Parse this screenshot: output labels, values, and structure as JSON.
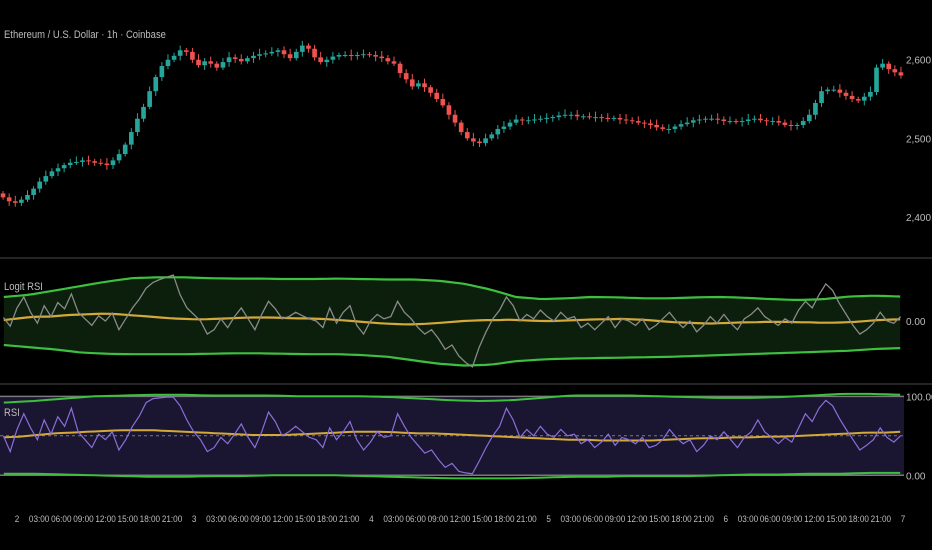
{
  "header": {
    "title": "Ethereum / U.S. Dollar · 1h · Coinbase"
  },
  "colors": {
    "background": "#000000",
    "candle_up": "#26a69a",
    "candle_down": "#ef5350",
    "band": "#3fbf3f",
    "signal": "#d4a93a",
    "logit_line": "#8a8a8a",
    "rsi_line": "#8a6fd8",
    "rsi_fill": "#1a1530",
    "logit_fill": "#0c1e0c",
    "divider": "#4a4a4a",
    "axis_text": "#bdbdbd"
  },
  "chart_data": [
    {
      "type": "candlestick",
      "title": "Ethereum / U.S. Dollar · 1h · Coinbase",
      "y_ticks": [
        "2,600.00",
        "2,500.00",
        "2,400.00"
      ],
      "y_tick_values": [
        2600,
        2500,
        2400
      ],
      "ylim": [
        2358,
        2648
      ],
      "x_ticks": [
        "2",
        "03:00",
        "06:00",
        "09:00",
        "12:00",
        "15:00",
        "18:00",
        "21:00",
        "3",
        "03:00",
        "06:00",
        "09:00",
        "12:00",
        "15:00",
        "18:00",
        "21:00",
        "4",
        "03:00",
        "06:00",
        "09:00",
        "12:00",
        "15:00",
        "18:00",
        "21:00",
        "5",
        "03:00",
        "06:00",
        "09:00",
        "12:00",
        "15:00",
        "18:00",
        "21:00",
        "6",
        "03:00",
        "06:00",
        "09:00",
        "12:00",
        "15:00",
        "18:00",
        "21:00",
        "7"
      ],
      "close": [
        2425,
        2420,
        2418,
        2422,
        2428,
        2436,
        2445,
        2452,
        2458,
        2462,
        2466,
        2469,
        2470,
        2472,
        2471,
        2469,
        2468,
        2466,
        2472,
        2480,
        2492,
        2508,
        2525,
        2540,
        2560,
        2578,
        2592,
        2600,
        2605,
        2612,
        2610,
        2600,
        2593,
        2598,
        2595,
        2590,
        2597,
        2603,
        2601,
        2598,
        2602,
        2605,
        2607,
        2608,
        2610,
        2612,
        2607,
        2602,
        2610,
        2618,
        2614,
        2603,
        2597,
        2600,
        2604,
        2606,
        2606,
        2605,
        2606,
        2607,
        2606,
        2604,
        2602,
        2598,
        2595,
        2583,
        2575,
        2566,
        2570,
        2565,
        2558,
        2550,
        2542,
        2530,
        2520,
        2508,
        2500,
        2496,
        2494,
        2500,
        2505,
        2512,
        2515,
        2520,
        2524,
        2523,
        2523,
        2524,
        2525,
        2526,
        2527,
        2529,
        2530,
        2530,
        2528,
        2528,
        2527,
        2527,
        2526,
        2525,
        2526,
        2524,
        2523,
        2522,
        2520,
        2519,
        2517,
        2514,
        2512,
        2512,
        2515,
        2518,
        2520,
        2523,
        2524,
        2525,
        2525,
        2524,
        2522,
        2522,
        2521,
        2522,
        2524,
        2525,
        2523,
        2522,
        2522,
        2520,
        2517,
        2516,
        2517,
        2522,
        2530,
        2545,
        2560,
        2562,
        2562,
        2558,
        2554,
        2550,
        2548,
        2553,
        2559,
        2590,
        2595,
        2588,
        2584,
        2580
      ]
    },
    {
      "type": "line",
      "title": "Logit RSI",
      "y_ticks": [
        "0.00"
      ],
      "y_tick_values": [
        0
      ],
      "ylim": [
        -1.35,
        1.35
      ],
      "series": [
        {
          "role": "logit_rsi",
          "values": [
            0.08,
            -0.12,
            0.3,
            0.55,
            0.2,
            -0.05,
            0.35,
            0.1,
            0.42,
            0.28,
            0.62,
            0.2,
            0.05,
            -0.1,
            0.12,
            0.0,
            0.18,
            -0.2,
            0.05,
            0.3,
            0.5,
            0.75,
            0.88,
            0.95,
            1.0,
            1.05,
            0.6,
            0.3,
            0.15,
            0.0,
            -0.3,
            -0.2,
            0.05,
            -0.15,
            0.1,
            0.3,
            0.05,
            -0.2,
            0.15,
            0.45,
            0.28,
            0.05,
            0.1,
            0.2,
            0.12,
            0.05,
            0.0,
            -0.15,
            0.3,
            -0.05,
            0.2,
            0.35,
            -0.1,
            -0.3,
            0.0,
            0.15,
            0.05,
            0.1,
            0.45,
            0.2,
            0.05,
            -0.15,
            -0.3,
            -0.2,
            -0.4,
            -0.65,
            -0.55,
            -0.8,
            -0.95,
            -1.05,
            -0.6,
            -0.25,
            0.05,
            0.25,
            0.55,
            0.35,
            0.0,
            0.15,
            0.05,
            0.25,
            0.1,
            0.0,
            0.2,
            0.05,
            0.1,
            -0.15,
            -0.05,
            -0.2,
            -0.05,
            0.1,
            -0.15,
            0.05,
            0.0,
            -0.1,
            0.05,
            -0.2,
            -0.1,
            0.05,
            0.2,
            0.0,
            -0.15,
            0.0,
            -0.25,
            -0.1,
            0.1,
            -0.05,
            0.15,
            -0.05,
            -0.2,
            0.05,
            0.15,
            0.3,
            0.1,
            0.0,
            -0.1,
            0.05,
            -0.05,
            0.25,
            0.45,
            0.3,
            0.6,
            0.85,
            0.7,
            0.4,
            0.15,
            -0.1,
            -0.3,
            -0.2,
            -0.05,
            0.2,
            0.0,
            -0.05,
            0.1
          ]
        },
        {
          "role": "signal",
          "values": [
            0.02,
            0.05,
            0.08,
            0.1,
            0.1,
            0.12,
            0.14,
            0.15,
            0.16,
            0.17,
            0.16,
            0.14,
            0.12,
            0.1,
            0.08,
            0.06,
            0.05,
            0.04,
            0.04,
            0.05,
            0.06,
            0.07,
            0.08,
            0.08,
            0.08,
            0.07,
            0.06,
            0.06,
            0.05,
            0.04,
            0.02,
            0.0,
            -0.02,
            -0.04,
            -0.06,
            -0.07,
            -0.08,
            -0.07,
            -0.06,
            -0.04,
            -0.02,
            0.0,
            0.01,
            0.02,
            0.02,
            0.03,
            0.02,
            0.01,
            0.0,
            0.0,
            0.01,
            0.02,
            0.03,
            0.04,
            0.04,
            0.05,
            0.04,
            0.03,
            0.01,
            -0.01,
            -0.03,
            -0.04,
            -0.05,
            -0.06,
            -0.05,
            -0.04,
            -0.03,
            -0.03,
            -0.02,
            -0.02,
            -0.02,
            -0.03,
            -0.03,
            -0.04,
            -0.04,
            -0.03,
            -0.02,
            0.0,
            0.02,
            0.03,
            0.04
          ]
        },
        {
          "role": "upper_band",
          "values": [
            0.55,
            0.6,
            0.7,
            0.8,
            0.9,
            0.98,
            1.0,
            1.0,
            0.98,
            0.97,
            0.97,
            0.96,
            0.96,
            0.97,
            0.96,
            0.95,
            0.95,
            0.92,
            0.85,
            0.72,
            0.55,
            0.5,
            0.52,
            0.55,
            0.54,
            0.52,
            0.52,
            0.54,
            0.55,
            0.53,
            0.5,
            0.48,
            0.5,
            0.56,
            0.58,
            0.56
          ]
        },
        {
          "role": "lower_band",
          "values": [
            -0.55,
            -0.6,
            -0.65,
            -0.72,
            -0.75,
            -0.76,
            -0.76,
            -0.76,
            -0.75,
            -0.74,
            -0.74,
            -0.75,
            -0.76,
            -0.76,
            -0.78,
            -0.82,
            -0.9,
            -0.98,
            -1.02,
            -1.0,
            -0.92,
            -0.88,
            -0.86,
            -0.85,
            -0.84,
            -0.83,
            -0.82,
            -0.8,
            -0.78,
            -0.76,
            -0.74,
            -0.72,
            -0.7,
            -0.68,
            -0.64,
            -0.62
          ]
        }
      ]
    },
    {
      "type": "line",
      "title": "RSI",
      "y_ticks": [
        "100.00",
        "0.00"
      ],
      "y_tick_values": [
        100,
        0
      ],
      "ylim": [
        -6,
        108
      ],
      "hlines": [
        100,
        50,
        0
      ],
      "series": [
        {
          "role": "rsi",
          "values": [
            50,
            30,
            58,
            78,
            60,
            45,
            70,
            52,
            74,
            62,
            85,
            55,
            45,
            35,
            52,
            45,
            55,
            32,
            45,
            62,
            75,
            92,
            97,
            98,
            99,
            99,
            88,
            70,
            55,
            45,
            30,
            35,
            48,
            40,
            52,
            65,
            48,
            35,
            55,
            80,
            68,
            50,
            55,
            62,
            55,
            48,
            45,
            35,
            60,
            45,
            55,
            68,
            45,
            32,
            42,
            55,
            48,
            50,
            78,
            62,
            48,
            38,
            28,
            32,
            20,
            10,
            15,
            5,
            3,
            2,
            18,
            35,
            50,
            62,
            85,
            70,
            48,
            58,
            50,
            62,
            52,
            48,
            58,
            50,
            52,
            40,
            45,
            35,
            42,
            52,
            38,
            48,
            45,
            40,
            48,
            35,
            38,
            45,
            58,
            48,
            40,
            45,
            30,
            38,
            50,
            45,
            55,
            45,
            35,
            48,
            55,
            70,
            55,
            48,
            40,
            48,
            42,
            60,
            78,
            68,
            85,
            95,
            88,
            72,
            58,
            45,
            32,
            38,
            45,
            60,
            48,
            42,
            50
          ]
        },
        {
          "role": "signal",
          "values": [
            48,
            49,
            51,
            53,
            54,
            55,
            56,
            57,
            57,
            57,
            56,
            55,
            54,
            53,
            52,
            51,
            51,
            51,
            52,
            53,
            54,
            55,
            55,
            55,
            54,
            53,
            53,
            52,
            51,
            50,
            49,
            48,
            47,
            46,
            45,
            45,
            44,
            44,
            44,
            44,
            45,
            46,
            47,
            47,
            48,
            48,
            49,
            49,
            50,
            51,
            52,
            53,
            54,
            54,
            55
          ]
        },
        {
          "role": "upper_band",
          "values": [
            92,
            94,
            97,
            100,
            101,
            102,
            102,
            101,
            101,
            101,
            100,
            100,
            100,
            99,
            97,
            95,
            94,
            95,
            98,
            101,
            101,
            101,
            100,
            99,
            98,
            98,
            99,
            101,
            103,
            103,
            102
          ]
        },
        {
          "role": "lower_band",
          "values": [
            2,
            2,
            1,
            0,
            -1,
            -2,
            -2,
            -1,
            -1,
            0,
            0,
            0,
            -1,
            -2,
            -3,
            -4,
            -4,
            -4,
            -3,
            -2,
            -2,
            -1,
            -1,
            -1,
            0,
            1,
            1,
            2,
            2,
            3,
            3
          ]
        }
      ]
    }
  ]
}
